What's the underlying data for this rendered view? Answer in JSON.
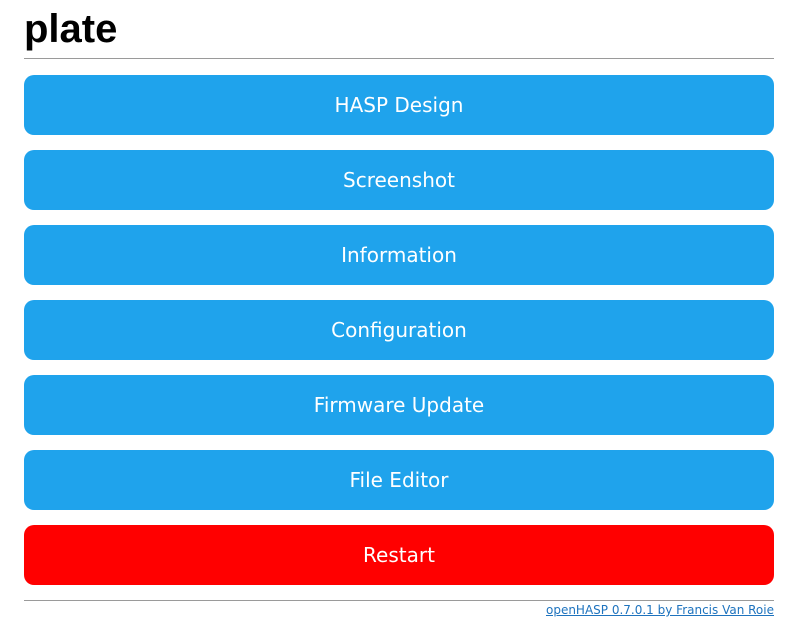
{
  "header": {
    "title": "plate"
  },
  "menu": {
    "buttons": [
      {
        "label": "HASP Design"
      },
      {
        "label": "Screenshot"
      },
      {
        "label": "Information"
      },
      {
        "label": "Configuration"
      },
      {
        "label": "Firmware Update"
      },
      {
        "label": "File Editor"
      },
      {
        "label": "Restart"
      }
    ]
  },
  "footer": {
    "link_text": "openHASP 0.7.0.1 by Francis Van Roie"
  },
  "colors": {
    "primary": "#1fa3ec",
    "danger": "#ff0000",
    "link": "#1e73be"
  }
}
